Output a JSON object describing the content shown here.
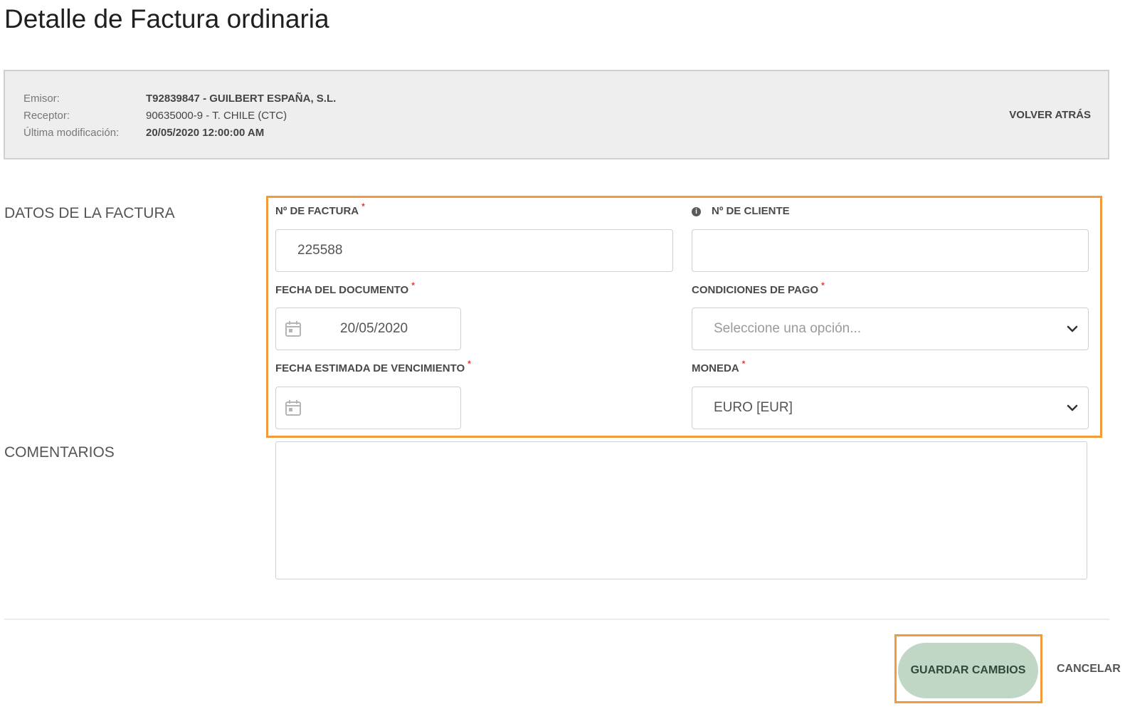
{
  "page": {
    "title": "Detalle de Factura ordinaria"
  },
  "info": {
    "emisor_label": "Emisor:",
    "emisor_value": "T92839847 - GUILBERT ESPAÑA, S.L.",
    "receptor_label": "Receptor:",
    "receptor_value": "90635000-9 - T. CHILE (CTC)",
    "modificacion_label": "Última modificación:",
    "modificacion_value": "20/05/2020 12:00:00 AM",
    "back_label": "VOLVER ATRÁS"
  },
  "sections": {
    "invoice_data": "DATOS DE LA FACTURA",
    "comments": "COMENTARIOS"
  },
  "form": {
    "invoice_number": {
      "label": "Nº DE FACTURA",
      "required": "*",
      "value": "225588"
    },
    "client_number": {
      "label": "Nº DE CLIENTE",
      "info_icon": "info-icon",
      "value": ""
    },
    "document_date": {
      "label": "FECHA DEL DOCUMENTO",
      "required": "*",
      "value": "20/05/2020"
    },
    "payment_terms": {
      "label": "CONDICIONES DE PAGO",
      "required": "*",
      "placeholder": "Seleccione una opción..."
    },
    "due_date": {
      "label": "FECHA ESTIMADA DE VENCIMIENTO",
      "required": "*",
      "value": ""
    },
    "currency": {
      "label": "MONEDA",
      "required": "*",
      "value": "EURO [EUR]"
    },
    "comments_value": ""
  },
  "actions": {
    "save": "GUARDAR CAMBIOS",
    "cancel": "CANCELAR"
  },
  "colors": {
    "highlight": "#f39b3a",
    "save_button": "#c0d7c6",
    "required_mark": "#e53935",
    "panel_background": "#eeeeee"
  }
}
